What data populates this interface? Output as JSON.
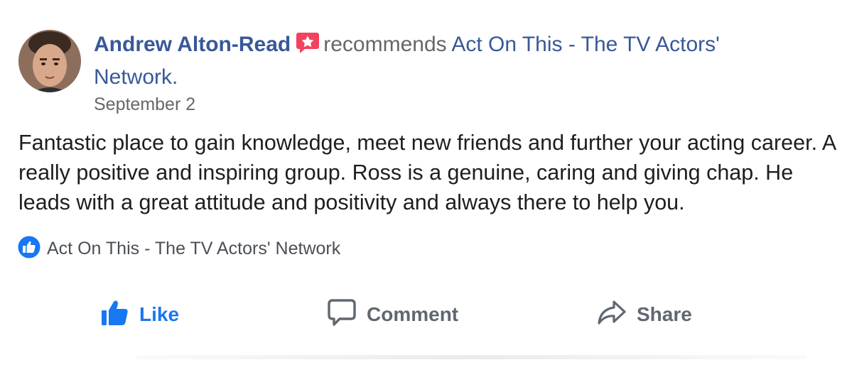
{
  "post": {
    "author": "Andrew Alton-Read",
    "verb": "recommends",
    "page_name": "Act On This - The TV Actors' Network.",
    "page_name_line1": "Act On This - The TV Actors'",
    "page_name_line2": "Network.",
    "timestamp": "September 2",
    "body": "Fantastic place to gain knowledge, meet new friends and further your acting career. A really positive and inspiring group. Ross is a genuine, caring and giving chap. He leads with a great attitude and positivity and always there to help you."
  },
  "recommendation": {
    "icon": "recommend-thumb-icon",
    "label": "Act On This - The TV Actors' Network"
  },
  "actions": {
    "like_label": "Like",
    "comment_label": "Comment",
    "share_label": "Share"
  },
  "colors": {
    "link": "#385898",
    "meta": "#65676b",
    "accent": "#1877f2",
    "badge": "#f3425f"
  }
}
